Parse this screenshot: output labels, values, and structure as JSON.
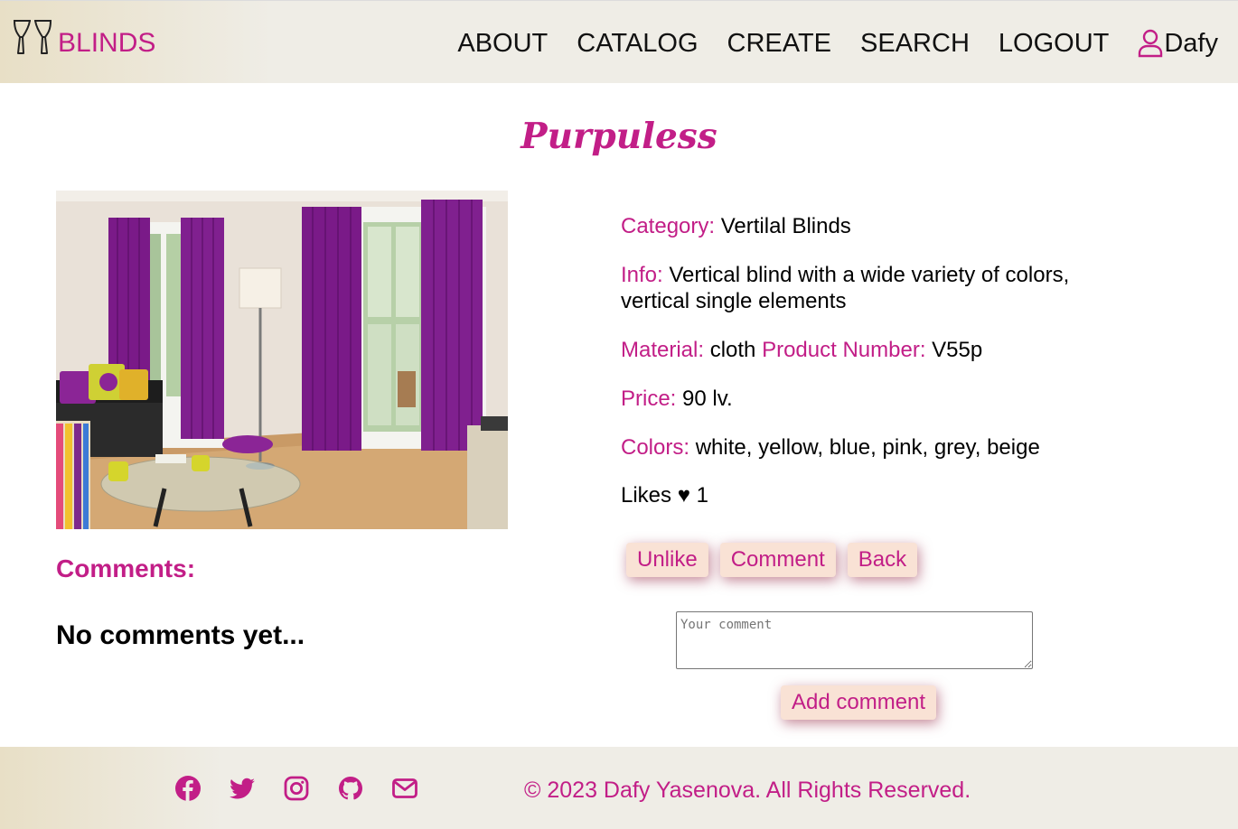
{
  "header": {
    "logo_text": "BLINDS",
    "nav": [
      "ABOUT",
      "CATALOG",
      "CREATE",
      "SEARCH",
      "LOGOUT"
    ],
    "user": "Dafy"
  },
  "product": {
    "title": "Purpuless",
    "category_label": "Category:",
    "category": "Vertilal Blinds",
    "info_label": "Info:",
    "info": "Vertical blind with a wide variety of colors, vertical single elements",
    "material_label": "Material:",
    "material": "cloth",
    "product_number_label": "Product Number:",
    "product_number": "V55p",
    "price_label": "Price:",
    "price": "90 lv.",
    "colors_label": "Colors:",
    "colors": "white, yellow, blue, pink, grey, beige",
    "likes_label": "Likes ♥",
    "likes": "1"
  },
  "actions": {
    "unlike": "Unlike",
    "comment": "Comment",
    "back": "Back",
    "add_comment": "Add comment"
  },
  "comment_form": {
    "placeholder": "Your comment"
  },
  "comments": {
    "heading": "Comments:",
    "empty": "No comments yet..."
  },
  "footer": {
    "icons": [
      "facebook-icon",
      "twitter-icon",
      "instagram-icon",
      "github-icon",
      "email-icon"
    ],
    "copyright": "© 2023 Dafy Yasenova. All Rights Reserved."
  },
  "colors": {
    "accent": "#c21e87",
    "button_bg": "#f9e2d5",
    "header_bg": "#efede6"
  }
}
